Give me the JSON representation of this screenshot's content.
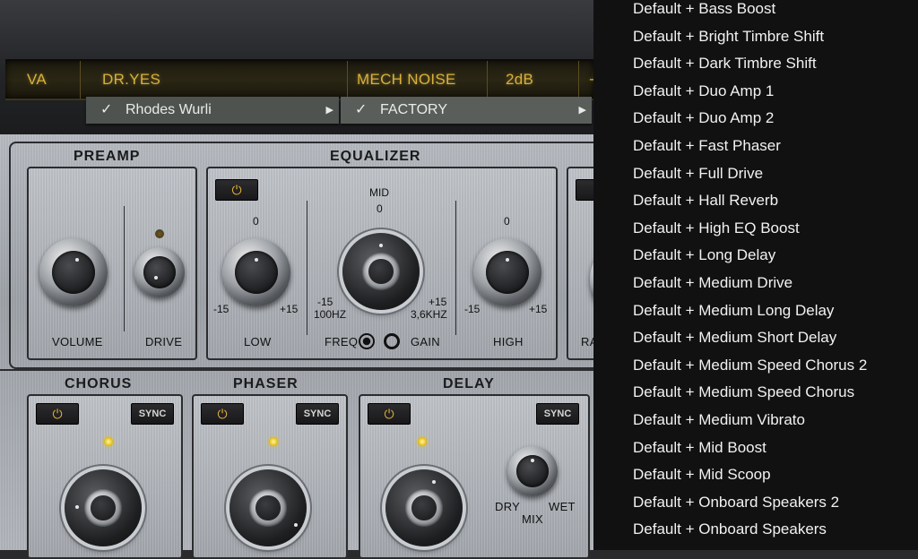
{
  "header": {
    "logo": "VA",
    "preset_name": "DR.YES",
    "fx_preset": "MECH NOISE",
    "level": "2dB",
    "extra": "┘"
  },
  "menus": {
    "instrument": {
      "check": "✓",
      "label": "Rhodes Wurli",
      "arrow": "▶"
    },
    "bank": {
      "check": "✓",
      "label": "FACTORY",
      "arrow": "▶"
    }
  },
  "preamp": {
    "title": "PREAMP",
    "volume_label": "VOLUME",
    "drive_label": "DRIVE"
  },
  "equalizer": {
    "title": "EQUALIZER",
    "power": "⏻",
    "low": {
      "zero": "0",
      "min": "-15",
      "max": "+15",
      "label": "LOW"
    },
    "mid": {
      "title": "MID",
      "zero": "0",
      "min": "-15",
      "min_freq": "100HZ",
      "max": "+15",
      "max_freq": "3,6KHZ",
      "freq_label": "FREQ",
      "gain_label": "GAIN"
    },
    "high": {
      "zero": "0",
      "min": "-15",
      "max": "+15",
      "label": "HIGH"
    },
    "ra_label": "RA"
  },
  "chorus": {
    "title": "CHORUS",
    "power": "⏻",
    "sync": "SYNC"
  },
  "phaser": {
    "title": "PHASER",
    "power": "⏻",
    "sync": "SYNC"
  },
  "delay": {
    "title": "DELAY",
    "power": "⏻",
    "sync": "SYNC",
    "dry": "DRY",
    "mix": "MIX",
    "wet": "WET"
  },
  "preset_list": [
    "Default + Bass Boost",
    "Default + Bright Timbre Shift",
    "Default + Dark Timbre Shift",
    "Default + Duo Amp 1",
    "Default + Duo Amp 2",
    "Default + Fast Phaser",
    "Default + Full Drive",
    "Default + Hall Reverb",
    "Default + High EQ Boost",
    "Default + Long Delay",
    "Default + Medium Drive",
    "Default + Medium Long Delay",
    "Default + Medium Short Delay",
    "Default + Medium Speed Chorus 2",
    "Default + Medium Speed Chorus",
    "Default + Medium Vibrato",
    "Default + Mid Boost",
    "Default + Mid Scoop",
    "Default + Onboard Speakers 2",
    "Default + Onboard Speakers"
  ],
  "colors": {
    "lcd_text": "#d8b03c",
    "led_on": "#e8c21e",
    "menu_bg": "#4f5350",
    "list_bg": "#111112"
  }
}
